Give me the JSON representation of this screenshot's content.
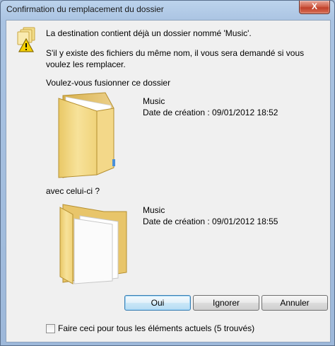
{
  "window": {
    "title": "Confirmation du remplacement du dossier",
    "close_label": "X"
  },
  "message": {
    "line1": "La destination contient déjà un dossier nommé 'Music'.",
    "line2": "S'il y existe des fichiers du même nom, il vous sera demandé si vous voulez les remplacer.",
    "question": "Voulez-vous fusionner ce dossier"
  },
  "source_folder": {
    "name": "Music",
    "date_label": "Date de création : 09/01/2012 18:52"
  },
  "with_label": "avec celui-ci ?",
  "target_folder": {
    "name": "Music",
    "date_label": "Date de création : 09/01/2012 18:55"
  },
  "buttons": {
    "yes": "Oui",
    "ignore": "Ignorer",
    "cancel": "Annuler"
  },
  "apply_all": {
    "label": "Faire ceci pour tous les éléments actuels (5 trouvés)",
    "checked": false
  },
  "icons": {
    "warning": "folder-warning-icon",
    "folder": "folder-icon",
    "folder_with_files": "folder-with-documents-icon"
  }
}
